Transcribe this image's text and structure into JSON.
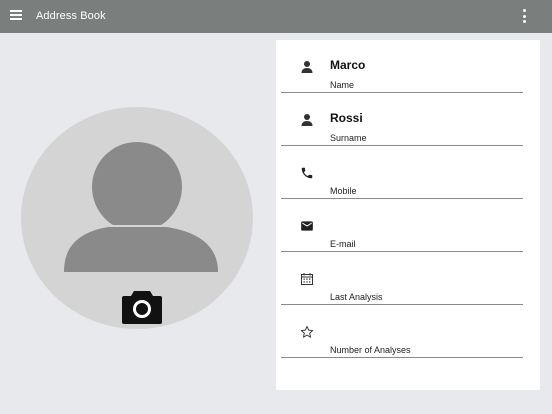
{
  "appbar": {
    "title": "Address Book",
    "menu_icon": "hamburger-menu-icon",
    "more_icon": "more-vertical-icon",
    "color": "#7a7f7e"
  },
  "avatar": {
    "icon": "person-avatar-icon",
    "camera_icon": "camera-icon"
  },
  "fields": [
    {
      "icon": "person-icon",
      "value": "Marco",
      "label": "Name"
    },
    {
      "icon": "person-icon",
      "value": "Rossi",
      "label": "Surname"
    },
    {
      "icon": "phone-icon",
      "value": "",
      "label": "Mobile"
    },
    {
      "icon": "email-icon",
      "value": "",
      "label": "E-mail"
    },
    {
      "icon": "calendar-icon",
      "value": "",
      "label": "Last Analysis"
    },
    {
      "icon": "star-icon",
      "value": "",
      "label": "Number of Analyses"
    }
  ]
}
